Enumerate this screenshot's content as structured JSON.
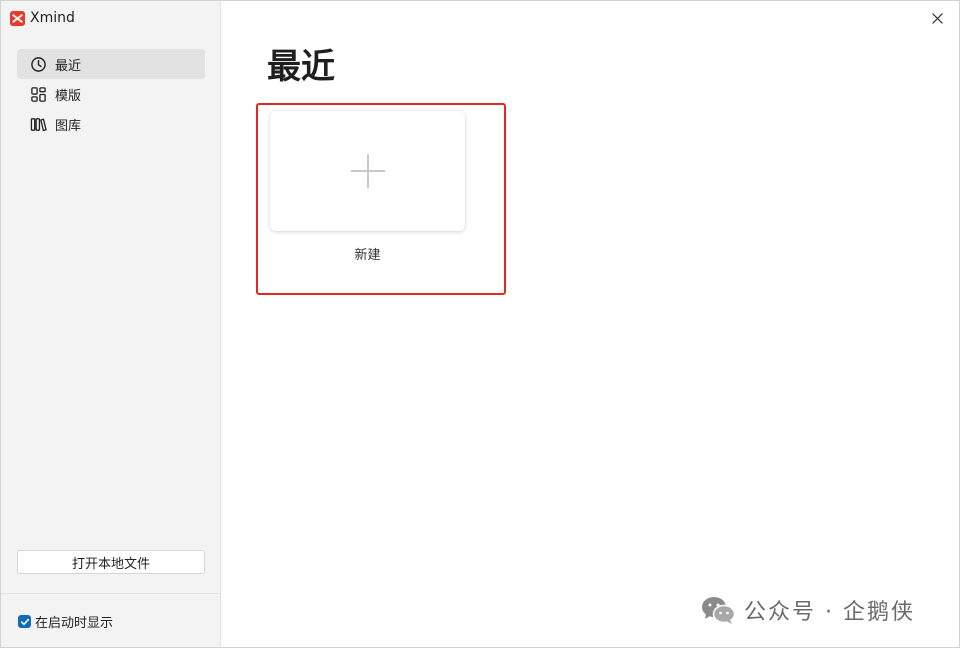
{
  "app": {
    "name": "Xmind"
  },
  "sidebar": {
    "items": [
      {
        "label": "最近",
        "icon": "clock-icon",
        "active": true
      },
      {
        "label": "模版",
        "icon": "template-grid-icon",
        "active": false
      },
      {
        "label": "图库",
        "icon": "library-icon",
        "active": false
      }
    ],
    "open_local_label": "打开本地文件",
    "startup_label": "在启动时显示",
    "startup_checked": true
  },
  "main": {
    "title": "最近",
    "new_card_label": "新建"
  },
  "watermark": {
    "text": "公众号 · 企鹅侠",
    "icon": "wechat-icon"
  },
  "colors": {
    "accent": "#0f6cbd",
    "highlight": "#e3281f",
    "sidebar_bg": "#f3f3f3",
    "active_item_bg": "#e2e2e2",
    "logo_red": "#e53b2c"
  }
}
